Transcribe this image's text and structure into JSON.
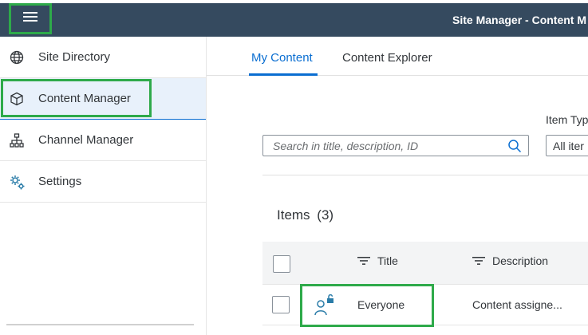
{
  "shellbar": {
    "title": "Site Manager - Content M",
    "menu_icon": "hamburger-menu-icon",
    "background": "#354a5f"
  },
  "sidebar": {
    "items": [
      {
        "label": "Site Directory",
        "icon": "globe-icon",
        "selected": false
      },
      {
        "label": "Content Manager",
        "icon": "cube-icon",
        "selected": true
      },
      {
        "label": "Channel Manager",
        "icon": "hierarchy-icon",
        "selected": false
      },
      {
        "label": "Settings",
        "icon": "gears-icon",
        "selected": false
      }
    ]
  },
  "tabs": [
    {
      "label": "My Content",
      "active": true
    },
    {
      "label": "Content Explorer",
      "active": false
    }
  ],
  "filters": {
    "search_placeholder": "Search in title, description, ID",
    "item_type_label": "Item Typ",
    "item_type_value": "All iter"
  },
  "items": {
    "title": "Items",
    "count": "(3)"
  },
  "table": {
    "columns": [
      {
        "label": "Title"
      },
      {
        "label": "Description"
      }
    ],
    "rows": [
      {
        "title": "Everyone",
        "description": "Content assigne...",
        "icon": "user-unlock-icon"
      }
    ]
  },
  "colors": {
    "accent": "#0a6ed1",
    "highlight": "#2eaa4a",
    "selected_bg": "#e8f1fb",
    "icon_teal": "#2a7ca8"
  }
}
